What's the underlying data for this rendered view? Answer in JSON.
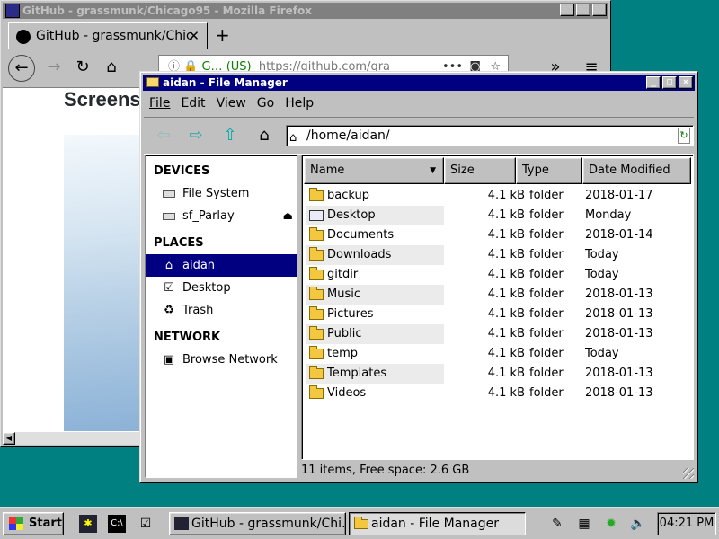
{
  "firefox": {
    "window_title": "GitHub - grassmunk/Chicago95 - Mozilla Firefox",
    "tab_title": "GitHub - grassmunk/Chic",
    "url_info": "G… (US)",
    "url": "https://github.com/gra",
    "page_heading": "Screens"
  },
  "file_manager": {
    "window_title": "aidan - File Manager",
    "menu": [
      "File",
      "Edit",
      "View",
      "Go",
      "Help"
    ],
    "location": "/home/aidan/",
    "sidebar": {
      "devices_header": "DEVICES",
      "devices": [
        {
          "label": "File System",
          "icon": "drive-icon"
        },
        {
          "label": "sf_Parlay",
          "icon": "drive-icon"
        }
      ],
      "places_header": "PLACES",
      "places": [
        {
          "label": "aidan",
          "icon": "home-icon",
          "selected": true
        },
        {
          "label": "Desktop",
          "icon": "desktop-icon"
        },
        {
          "label": "Trash",
          "icon": "trash-icon"
        }
      ],
      "network_header": "NETWORK",
      "network": [
        {
          "label": "Browse Network",
          "icon": "network-icon"
        }
      ]
    },
    "columns": {
      "name": "Name",
      "size": "Size",
      "type": "Type",
      "date": "Date Modified"
    },
    "files": [
      {
        "name": "backup",
        "size": "4.1 kB",
        "type": "folder",
        "date": "2018-01-17",
        "icon": "folder-icon"
      },
      {
        "name": "Desktop",
        "size": "4.1 kB",
        "type": "folder",
        "date": "Monday",
        "icon": "desktop-icon"
      },
      {
        "name": "Documents",
        "size": "4.1 kB",
        "type": "folder",
        "date": "2018-01-14",
        "icon": "folder-icon"
      },
      {
        "name": "Downloads",
        "size": "4.1 kB",
        "type": "folder",
        "date": "Today",
        "icon": "folder-icon"
      },
      {
        "name": "gitdir",
        "size": "4.1 kB",
        "type": "folder",
        "date": "Today",
        "icon": "folder-icon"
      },
      {
        "name": "Music",
        "size": "4.1 kB",
        "type": "folder",
        "date": "2018-01-13",
        "icon": "folder-icon"
      },
      {
        "name": "Pictures",
        "size": "4.1 kB",
        "type": "folder",
        "date": "2018-01-13",
        "icon": "folder-icon"
      },
      {
        "name": "Public",
        "size": "4.1 kB",
        "type": "folder",
        "date": "2018-01-13",
        "icon": "folder-icon"
      },
      {
        "name": "temp",
        "size": "4.1 kB",
        "type": "folder",
        "date": "Today",
        "icon": "folder-icon"
      },
      {
        "name": "Templates",
        "size": "4.1 kB",
        "type": "folder",
        "date": "2018-01-13",
        "icon": "folder-icon"
      },
      {
        "name": "Videos",
        "size": "4.1 kB",
        "type": "folder",
        "date": "2018-01-13",
        "icon": "folder-icon"
      }
    ],
    "status": "11 items, Free space: 2.6 GB"
  },
  "taskbar": {
    "start_label": "Start",
    "tasks": [
      {
        "label": "GitHub - grassmunk/Chi…",
        "active": false
      },
      {
        "label": "aidan - File Manager",
        "active": true
      }
    ],
    "clock": "04:21 PM"
  },
  "colors": {
    "desktop": "#008080",
    "titlebar_active": "#000080",
    "titlebar_inactive": "#808080",
    "face": "#c0c0c0"
  }
}
